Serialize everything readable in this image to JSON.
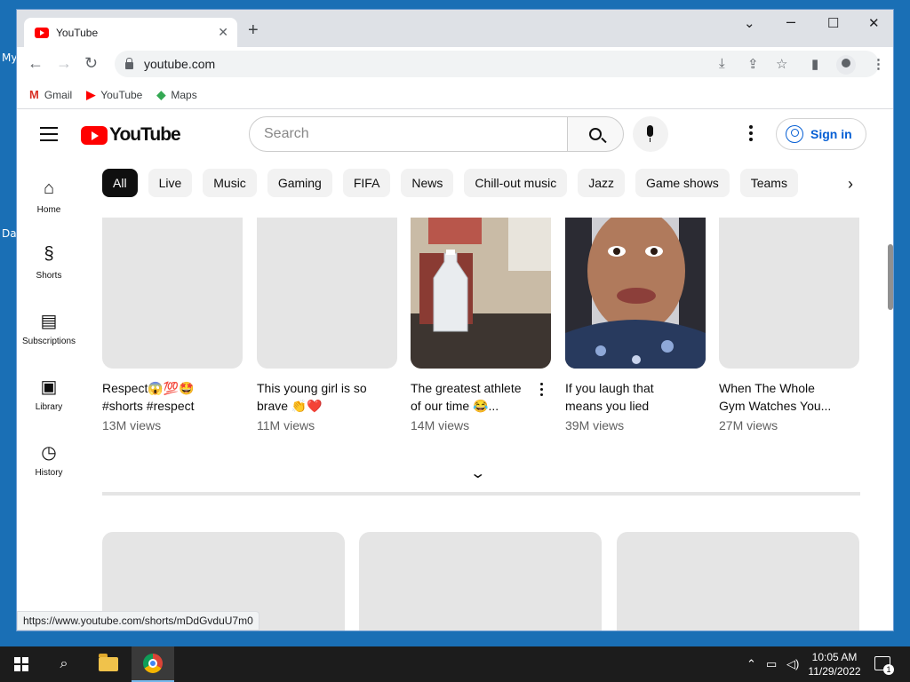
{
  "desktop": {
    "hints": [
      "My",
      "Da"
    ]
  },
  "browser": {
    "tab_title": "YouTube",
    "tab_close": "✕",
    "new_tab": "+",
    "url": "youtube.com",
    "bookmarks": [
      {
        "label": "Gmail",
        "icon": "gmail-icon"
      },
      {
        "label": "YouTube",
        "icon": "youtube-icon"
      },
      {
        "label": "Maps",
        "icon": "maps-icon"
      }
    ],
    "status_url": "https://www.youtube.com/shorts/mDdGvduU7m0"
  },
  "youtube": {
    "logo_text": "YouTube",
    "search_placeholder": "Search",
    "signin_label": "Sign in",
    "guide": [
      {
        "label": "Home",
        "icon": "home-icon"
      },
      {
        "label": "Shorts",
        "icon": "shorts-icon"
      },
      {
        "label": "Subscriptions",
        "icon": "subscriptions-icon"
      },
      {
        "label": "Library",
        "icon": "library-icon"
      },
      {
        "label": "History",
        "icon": "history-icon"
      }
    ],
    "chips": [
      "All",
      "Live",
      "Music",
      "Gaming",
      "FIFA",
      "News",
      "Chill-out music",
      "Jazz",
      "Game shows",
      "Teams"
    ],
    "shorts": [
      {
        "line1": "Respect😱💯🤩",
        "line2": "#shorts #respect",
        "views": "13M views"
      },
      {
        "line1": "This young girl is so",
        "line2": "brave 👏❤️",
        "views": "11M views"
      },
      {
        "line1": "The greatest athlete",
        "line2": "of our time 😂...",
        "views": "14M views"
      },
      {
        "line1": "If you laugh that",
        "line2": "means you lied",
        "views": "39M views"
      },
      {
        "line1": "When The Whole",
        "line2": "Gym Watches You...",
        "views": "27M views"
      }
    ]
  },
  "taskbar": {
    "time": "10:05 AM",
    "date": "11/29/2022",
    "notification_count": "1"
  },
  "colors": {
    "brand_red": "#ff0000",
    "link_blue": "#065fd4",
    "taskbar": "#1c1c1c"
  }
}
